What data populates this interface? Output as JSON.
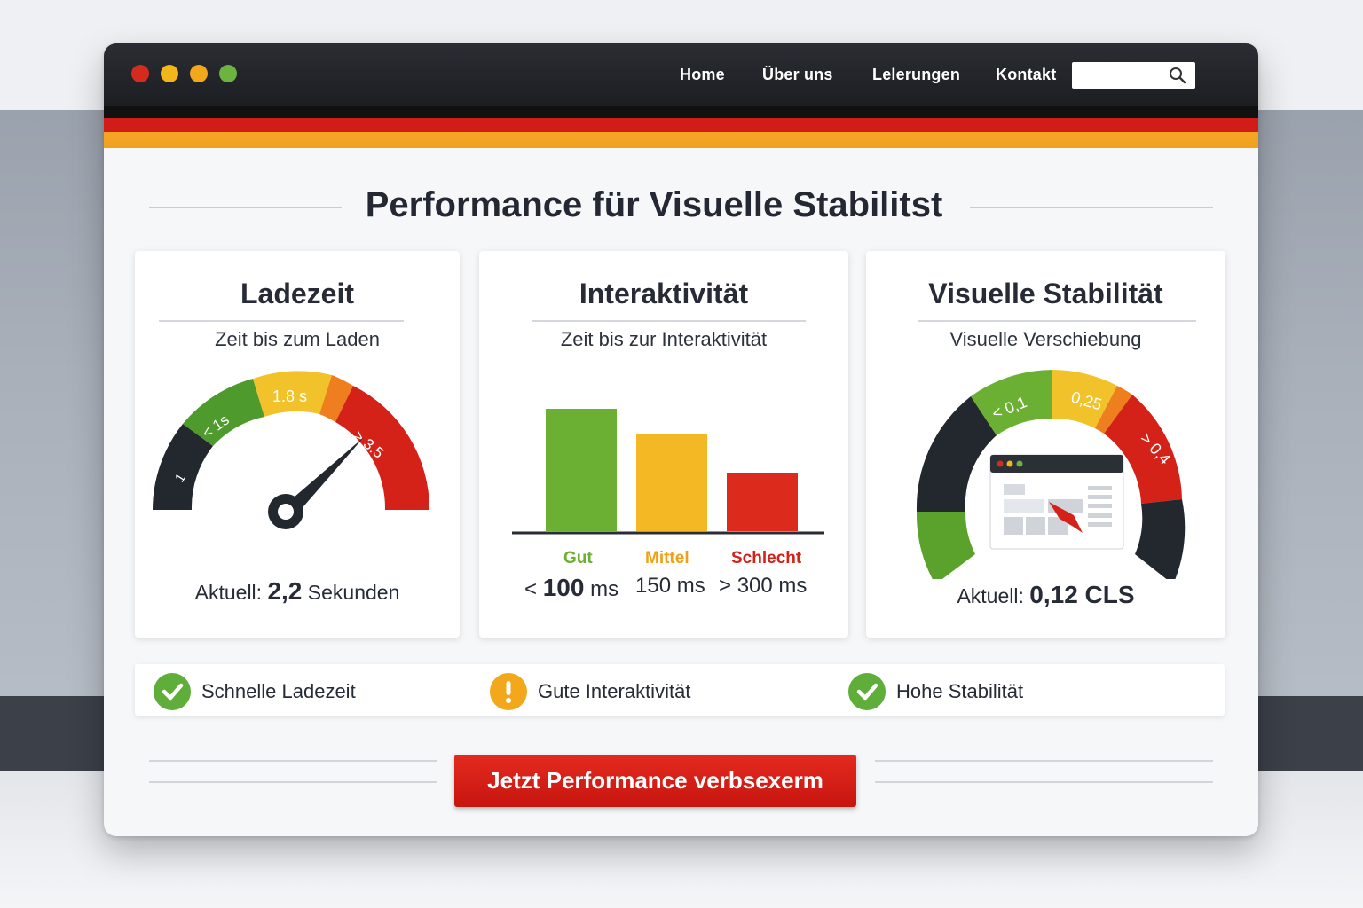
{
  "window_controls": [
    "#d42b1e",
    "#f2b51a",
    "#f2a81a",
    "#6cb33f"
  ],
  "nav": {
    "items": [
      {
        "label": "Home"
      },
      {
        "label": "Über uns"
      },
      {
        "label": "Lelerungen"
      },
      {
        "label": "Kontakt"
      }
    ],
    "search_placeholder": "",
    "search_icon": "search-icon"
  },
  "page_title": "Performance für Visuelle Stabilitst",
  "cards": {
    "load": {
      "title": "Ladezeit",
      "subtitle": "Zeit bis zum Laden",
      "gauge_labels": [
        "1",
        "< 1s",
        "1.8 s",
        "> 3.5"
      ],
      "needle_value": 2.2,
      "current_prefix": "Aktuell:",
      "current_value": "2,2",
      "current_unit": "Sekunden"
    },
    "interactivity": {
      "title": "Interaktivität",
      "subtitle": "Zeit bis zur Interaktivität",
      "bars": [
        {
          "label": "Gut",
          "prefix": "<",
          "value": "100",
          "unit": "ms",
          "ms": 100,
          "color": "#6cb033"
        },
        {
          "label": "Mittel",
          "prefix": "",
          "value": "150",
          "unit": "ms",
          "ms": 150,
          "color": "#f4b824"
        },
        {
          "label": "Schlecht",
          "prefix": ">",
          "value": "300",
          "unit": "ms",
          "ms": 300,
          "color": "#dc2a1c"
        }
      ],
      "label_colors": [
        "#6cb033",
        "#f0a010",
        "#d42218"
      ]
    },
    "stability": {
      "title": "Visuelle Stabilität",
      "subtitle": "Visuelle Verschiebung",
      "gauge_labels": [
        "< 0,1",
        "0,25",
        "> 0,4"
      ],
      "current_prefix": "Aktuell:",
      "current_value": "0,12 CLS"
    }
  },
  "status": [
    {
      "label": "Schnelle Ladezeit",
      "icon": "check-icon",
      "color": "#5fae3a"
    },
    {
      "label": "Gute Interaktivität",
      "icon": "warning-icon",
      "color": "#f2a81a"
    },
    {
      "label": "Hohe Stabilität",
      "icon": "check-icon",
      "color": "#5fae3a"
    }
  ],
  "cta": {
    "label": "Jetzt Performance verbsexerm"
  }
}
